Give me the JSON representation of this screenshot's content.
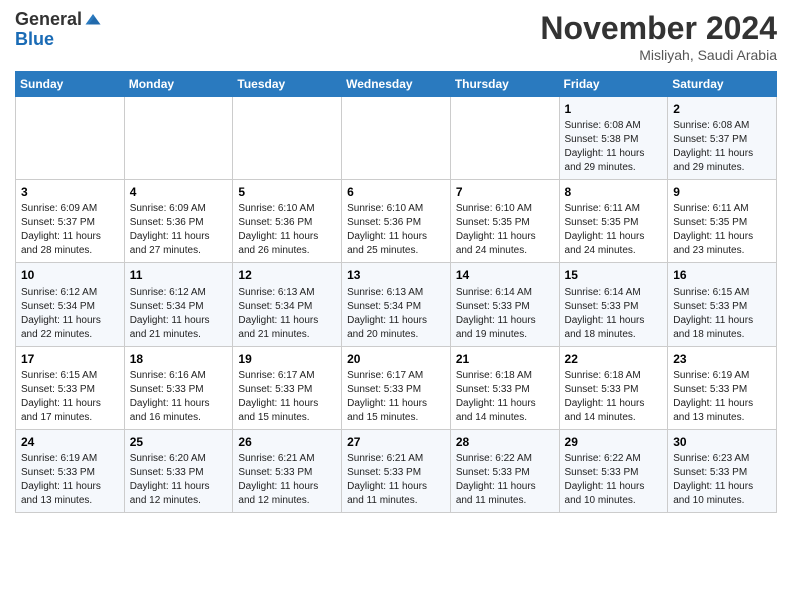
{
  "header": {
    "logo_general": "General",
    "logo_blue": "Blue",
    "month_title": "November 2024",
    "location": "Misliyah, Saudi Arabia"
  },
  "days_of_week": [
    "Sunday",
    "Monday",
    "Tuesday",
    "Wednesday",
    "Thursday",
    "Friday",
    "Saturday"
  ],
  "weeks": [
    [
      {
        "day": "",
        "info": ""
      },
      {
        "day": "",
        "info": ""
      },
      {
        "day": "",
        "info": ""
      },
      {
        "day": "",
        "info": ""
      },
      {
        "day": "",
        "info": ""
      },
      {
        "day": "1",
        "info": "Sunrise: 6:08 AM\nSunset: 5:38 PM\nDaylight: 11 hours\nand 29 minutes."
      },
      {
        "day": "2",
        "info": "Sunrise: 6:08 AM\nSunset: 5:37 PM\nDaylight: 11 hours\nand 29 minutes."
      }
    ],
    [
      {
        "day": "3",
        "info": "Sunrise: 6:09 AM\nSunset: 5:37 PM\nDaylight: 11 hours\nand 28 minutes."
      },
      {
        "day": "4",
        "info": "Sunrise: 6:09 AM\nSunset: 5:36 PM\nDaylight: 11 hours\nand 27 minutes."
      },
      {
        "day": "5",
        "info": "Sunrise: 6:10 AM\nSunset: 5:36 PM\nDaylight: 11 hours\nand 26 minutes."
      },
      {
        "day": "6",
        "info": "Sunrise: 6:10 AM\nSunset: 5:36 PM\nDaylight: 11 hours\nand 25 minutes."
      },
      {
        "day": "7",
        "info": "Sunrise: 6:10 AM\nSunset: 5:35 PM\nDaylight: 11 hours\nand 24 minutes."
      },
      {
        "day": "8",
        "info": "Sunrise: 6:11 AM\nSunset: 5:35 PM\nDaylight: 11 hours\nand 24 minutes."
      },
      {
        "day": "9",
        "info": "Sunrise: 6:11 AM\nSunset: 5:35 PM\nDaylight: 11 hours\nand 23 minutes."
      }
    ],
    [
      {
        "day": "10",
        "info": "Sunrise: 6:12 AM\nSunset: 5:34 PM\nDaylight: 11 hours\nand 22 minutes."
      },
      {
        "day": "11",
        "info": "Sunrise: 6:12 AM\nSunset: 5:34 PM\nDaylight: 11 hours\nand 21 minutes."
      },
      {
        "day": "12",
        "info": "Sunrise: 6:13 AM\nSunset: 5:34 PM\nDaylight: 11 hours\nand 21 minutes."
      },
      {
        "day": "13",
        "info": "Sunrise: 6:13 AM\nSunset: 5:34 PM\nDaylight: 11 hours\nand 20 minutes."
      },
      {
        "day": "14",
        "info": "Sunrise: 6:14 AM\nSunset: 5:33 PM\nDaylight: 11 hours\nand 19 minutes."
      },
      {
        "day": "15",
        "info": "Sunrise: 6:14 AM\nSunset: 5:33 PM\nDaylight: 11 hours\nand 18 minutes."
      },
      {
        "day": "16",
        "info": "Sunrise: 6:15 AM\nSunset: 5:33 PM\nDaylight: 11 hours\nand 18 minutes."
      }
    ],
    [
      {
        "day": "17",
        "info": "Sunrise: 6:15 AM\nSunset: 5:33 PM\nDaylight: 11 hours\nand 17 minutes."
      },
      {
        "day": "18",
        "info": "Sunrise: 6:16 AM\nSunset: 5:33 PM\nDaylight: 11 hours\nand 16 minutes."
      },
      {
        "day": "19",
        "info": "Sunrise: 6:17 AM\nSunset: 5:33 PM\nDaylight: 11 hours\nand 15 minutes."
      },
      {
        "day": "20",
        "info": "Sunrise: 6:17 AM\nSunset: 5:33 PM\nDaylight: 11 hours\nand 15 minutes."
      },
      {
        "day": "21",
        "info": "Sunrise: 6:18 AM\nSunset: 5:33 PM\nDaylight: 11 hours\nand 14 minutes."
      },
      {
        "day": "22",
        "info": "Sunrise: 6:18 AM\nSunset: 5:33 PM\nDaylight: 11 hours\nand 14 minutes."
      },
      {
        "day": "23",
        "info": "Sunrise: 6:19 AM\nSunset: 5:33 PM\nDaylight: 11 hours\nand 13 minutes."
      }
    ],
    [
      {
        "day": "24",
        "info": "Sunrise: 6:19 AM\nSunset: 5:33 PM\nDaylight: 11 hours\nand 13 minutes."
      },
      {
        "day": "25",
        "info": "Sunrise: 6:20 AM\nSunset: 5:33 PM\nDaylight: 11 hours\nand 12 minutes."
      },
      {
        "day": "26",
        "info": "Sunrise: 6:21 AM\nSunset: 5:33 PM\nDaylight: 11 hours\nand 12 minutes."
      },
      {
        "day": "27",
        "info": "Sunrise: 6:21 AM\nSunset: 5:33 PM\nDaylight: 11 hours\nand 11 minutes."
      },
      {
        "day": "28",
        "info": "Sunrise: 6:22 AM\nSunset: 5:33 PM\nDaylight: 11 hours\nand 11 minutes."
      },
      {
        "day": "29",
        "info": "Sunrise: 6:22 AM\nSunset: 5:33 PM\nDaylight: 11 hours\nand 10 minutes."
      },
      {
        "day": "30",
        "info": "Sunrise: 6:23 AM\nSunset: 5:33 PM\nDaylight: 11 hours\nand 10 minutes."
      }
    ]
  ]
}
